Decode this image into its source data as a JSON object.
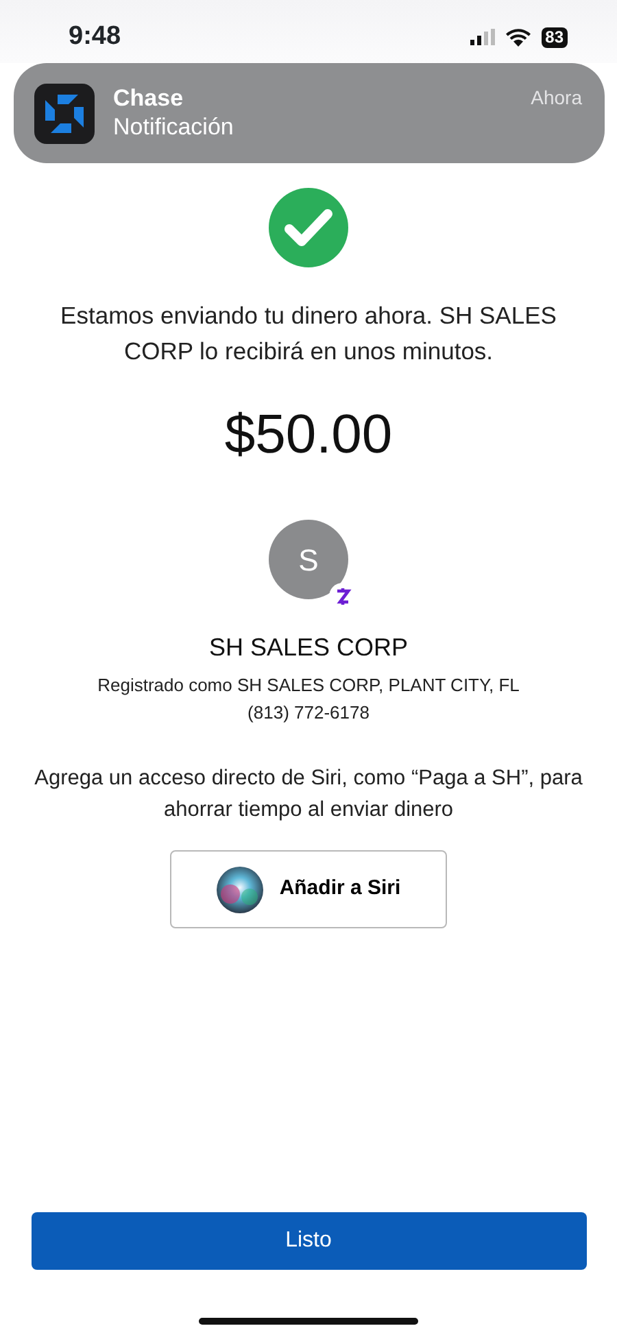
{
  "status_bar": {
    "time": "9:48",
    "battery": "83"
  },
  "notification": {
    "app": "Chase",
    "body": "Notificación",
    "time": "Ahora"
  },
  "message": "Estamos enviando tu dinero ahora. SH SALES CORP lo recibirá en unos minutos.",
  "amount": "$50.00",
  "recipient": {
    "initial": "S",
    "name": "SH SALES CORP",
    "registered": "Registrado como SH SALES CORP, PLANT CITY, FL",
    "phone": "(813) 772-6178"
  },
  "siri": {
    "hint": "Agrega un acceso directo de Siri, como “Paga a SH”, para ahorrar tiempo al enviar dinero",
    "button": "Añadir a Siri"
  },
  "done_button": "Listo"
}
